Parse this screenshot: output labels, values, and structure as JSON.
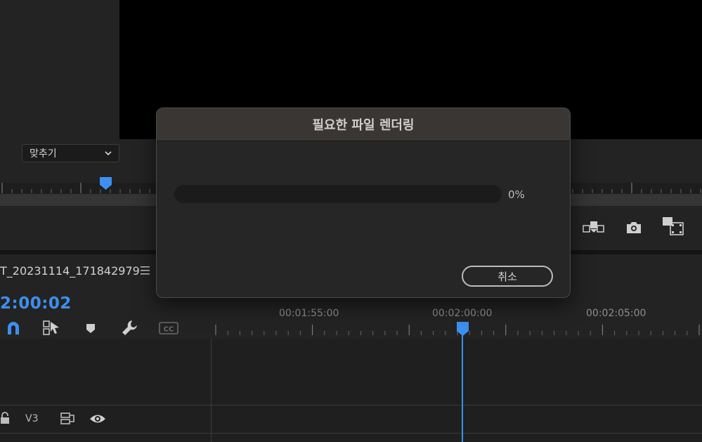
{
  "monitor": {
    "fit_select": {
      "value": "맞추기",
      "icon": "chevron-down-icon"
    },
    "controls": {
      "overwrite_icon": "overwrite-icon",
      "export_frame_icon": "camera-icon",
      "compare_icon": "comparison-view-icon"
    }
  },
  "timeline": {
    "sequence_name": "T_20231114_171842979",
    "timecode": "2:00:02",
    "ruler_labels": [
      "00:01:55:00",
      "00:02:00:00",
      "00:02:05:00"
    ],
    "tools": [
      "snap-magnet-icon",
      "linked-selection-icon",
      "add-marker-icon",
      "wrench-icon",
      "captions-icon"
    ],
    "tracks": [
      {
        "label": "V3"
      }
    ]
  },
  "dialog": {
    "title": "필요한 파일 렌더링",
    "progress": 0,
    "progress_label": "0%",
    "cancel_label": "취소"
  },
  "colors": {
    "accent": "#3d8ff0",
    "panel_bg": "#232323",
    "dialog_title_bg": "#3a3633"
  }
}
